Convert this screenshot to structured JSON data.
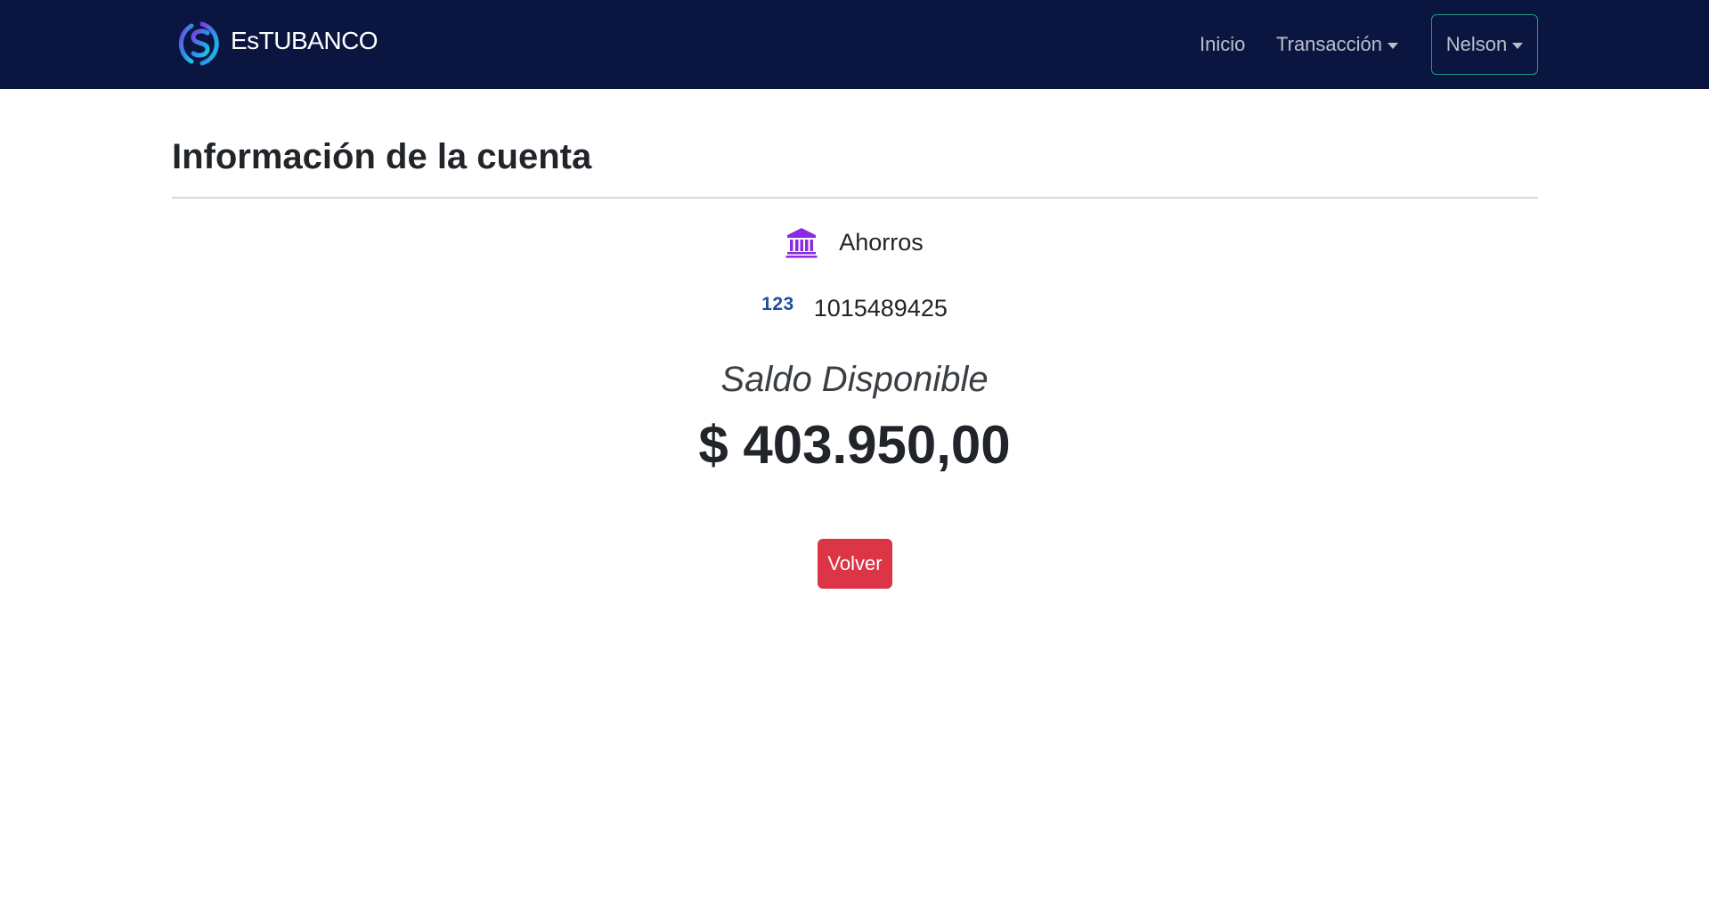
{
  "navbar": {
    "brand_name": "EsTUBANCO",
    "links": {
      "inicio": "Inicio",
      "transaccion": "Transacción"
    },
    "user_menu": "Nelson"
  },
  "account": {
    "title": "Información de la cuenta",
    "type_label": "Ahorros",
    "number_icon_text": "123",
    "account_number": "1015489425",
    "balance_label": "Saldo Disponible",
    "balance_amount": "$ 403.950,00"
  },
  "actions": {
    "back_label": "Volver"
  },
  "icons": {
    "brand": "dollar-logo-icon",
    "account_type": "bank-icon",
    "account_number": "numbers-icon",
    "dropdown": "caret-down-icon"
  },
  "colors": {
    "navbar_bg": "#0a1640",
    "bank_icon": "#8a2be2",
    "number_icon": "#1f4e9a",
    "back_button": "#dc3545",
    "user_button_border": "#1e9a7a"
  }
}
